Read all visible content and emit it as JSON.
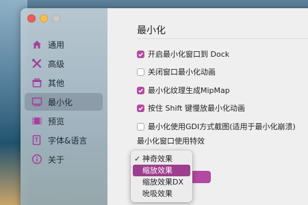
{
  "window": {
    "traffic_lights": [
      "close",
      "minimize",
      "zoom"
    ]
  },
  "sidebar": {
    "items": [
      {
        "label": "通用",
        "icon": "house-icon"
      },
      {
        "label": "高级",
        "icon": "tools-icon"
      },
      {
        "label": "其他",
        "icon": "gift-icon"
      },
      {
        "label": "最小化",
        "icon": "dock-icon",
        "active": true
      },
      {
        "label": "预览",
        "icon": "film-icon"
      },
      {
        "label": "字体&语言",
        "icon": "font-icon"
      },
      {
        "label": "关于",
        "icon": "info-icon"
      }
    ]
  },
  "main": {
    "title": "最小化",
    "options": [
      {
        "label": "开启最小化窗口到 Dock",
        "checked": true
      },
      {
        "label": "关闭窗口最小化动画",
        "checked": false
      },
      {
        "label": "最小化纹理生成MipMap",
        "checked": true
      },
      {
        "label": "按住 Shift 键慢放最小化动画",
        "checked": true
      },
      {
        "label": "最小化使用GDI方式截图(适用于最小化崩溃)",
        "checked": false
      }
    ],
    "effect_label": "最小化窗口使用特效",
    "effect_menu": {
      "items": [
        {
          "label": "神奇效果",
          "checked": true
        },
        {
          "label": "缩放效果",
          "highlighted": true
        },
        {
          "label": "缩放效果DX"
        },
        {
          "label": "吮吸效果"
        }
      ]
    }
  },
  "colors": {
    "accent": "#b14aa0",
    "highlight": "#9d3e8e"
  }
}
